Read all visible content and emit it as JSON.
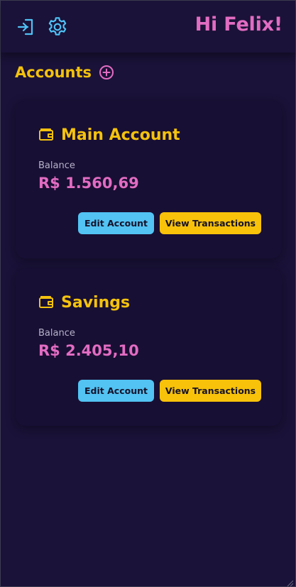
{
  "header": {
    "greeting": "Hi Felix!",
    "logout_icon": "logout-icon",
    "settings_icon": "gear-icon"
  },
  "accounts_section": {
    "title": "Accounts",
    "add_icon": "plus-circle-icon"
  },
  "accounts": [
    {
      "name": "Main Account",
      "balance_label": "Balance",
      "balance": "R$ 1.560,69",
      "edit_label": "Edit Account",
      "view_label": "View Transactions",
      "icon": "wallet-icon"
    },
    {
      "name": "Savings",
      "balance_label": "Balance",
      "balance": "R$ 2.405,10",
      "edit_label": "Edit Account",
      "view_label": "View Transactions",
      "icon": "wallet-icon"
    }
  ],
  "colors": {
    "background": "#1a1238",
    "card": "#180f34",
    "accent_yellow": "#f4c20d",
    "accent_pink": "#e26cc2",
    "accent_blue": "#52c3f3"
  }
}
